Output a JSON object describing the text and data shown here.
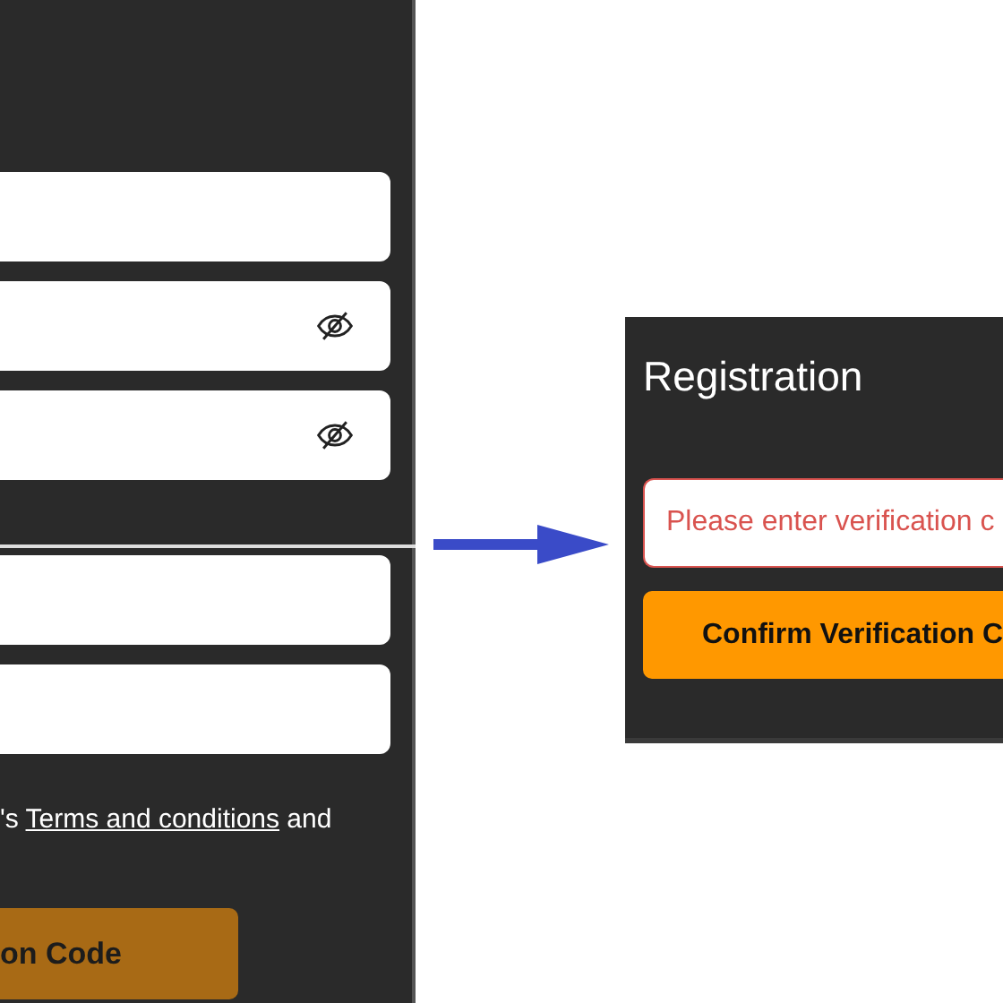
{
  "left_form": {
    "fields": [
      {
        "kind": "text"
      },
      {
        "kind": "password"
      },
      {
        "kind": "password"
      }
    ],
    "fields_after_divider": [
      {
        "kind": "text"
      },
      {
        "kind": "text"
      }
    ],
    "agreement": {
      "before": "'s",
      "link": "Terms and conditions",
      "after": "and"
    },
    "button": {
      "label": "on Code",
      "disabled": true
    }
  },
  "registration": {
    "title": "Registration",
    "code_field": {
      "placeholder": "Please enter verification c",
      "error": true
    },
    "button": {
      "label": "Confirm Verification C",
      "disabled": false
    }
  }
}
